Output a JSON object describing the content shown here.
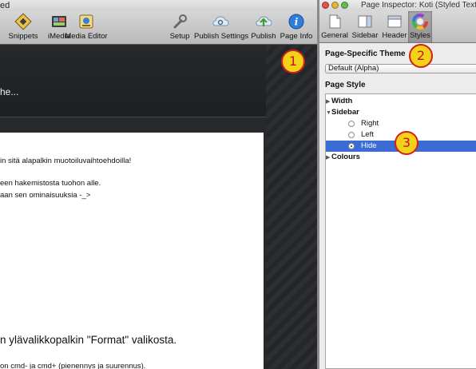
{
  "main_window": {
    "title_fragment": "ed",
    "toolbar": [
      {
        "name": "snippets",
        "label": "Snippets",
        "icon": "snippets-icon"
      },
      {
        "name": "imedia",
        "label": "iMedia",
        "icon": "imedia-icon"
      },
      {
        "name": "media-editor",
        "label": "Media Editor",
        "icon": "media-editor-icon"
      },
      {
        "name": "setup",
        "label": "Setup",
        "icon": "wrench-icon"
      },
      {
        "name": "publish-settings",
        "label": "Publish Settings",
        "icon": "cloud-gear-icon"
      },
      {
        "name": "publish",
        "label": "Publish",
        "icon": "cloud-upload-icon"
      },
      {
        "name": "page-info",
        "label": "Page Info",
        "icon": "info-icon"
      }
    ],
    "header_text": "he...",
    "content_lines": [
      "in sitä alapalkin muotoiluvaihtoehdoilla!",
      "een hakemistosta tuohon alle.",
      "aan sen ominaisuuksia -_>",
      "n ylävalikkopalkin \"Format\" valikosta.",
      "on cmd- ja cmd+ (pienennys ja suurennus)."
    ]
  },
  "inspector": {
    "title": "Page Inspector: Koti (Styled Text)",
    "tabs": [
      {
        "label": "General",
        "icon": "page-icon"
      },
      {
        "label": "Sidebar",
        "icon": "sidebar-icon"
      },
      {
        "label": "Header",
        "icon": "header-icon"
      },
      {
        "label": "Styles",
        "icon": "color-wheel-icon",
        "active": true
      }
    ],
    "page_specific_theme_label": "Page-Specific Theme",
    "theme_value": "Default (Alpha)",
    "page_style_label": "Page Style",
    "tree": {
      "width": "Width",
      "sidebar": "Sidebar",
      "options": [
        "Right",
        "Left",
        "Hide"
      ],
      "selected": "Hide",
      "colours": "Colours"
    }
  },
  "callouts": [
    "1",
    "2",
    "3"
  ],
  "colors": {
    "badge_fill": "#f4d21a",
    "badge_border": "#d0201b",
    "selection": "#3b6cd6",
    "canvas_dark": "#27292c"
  }
}
